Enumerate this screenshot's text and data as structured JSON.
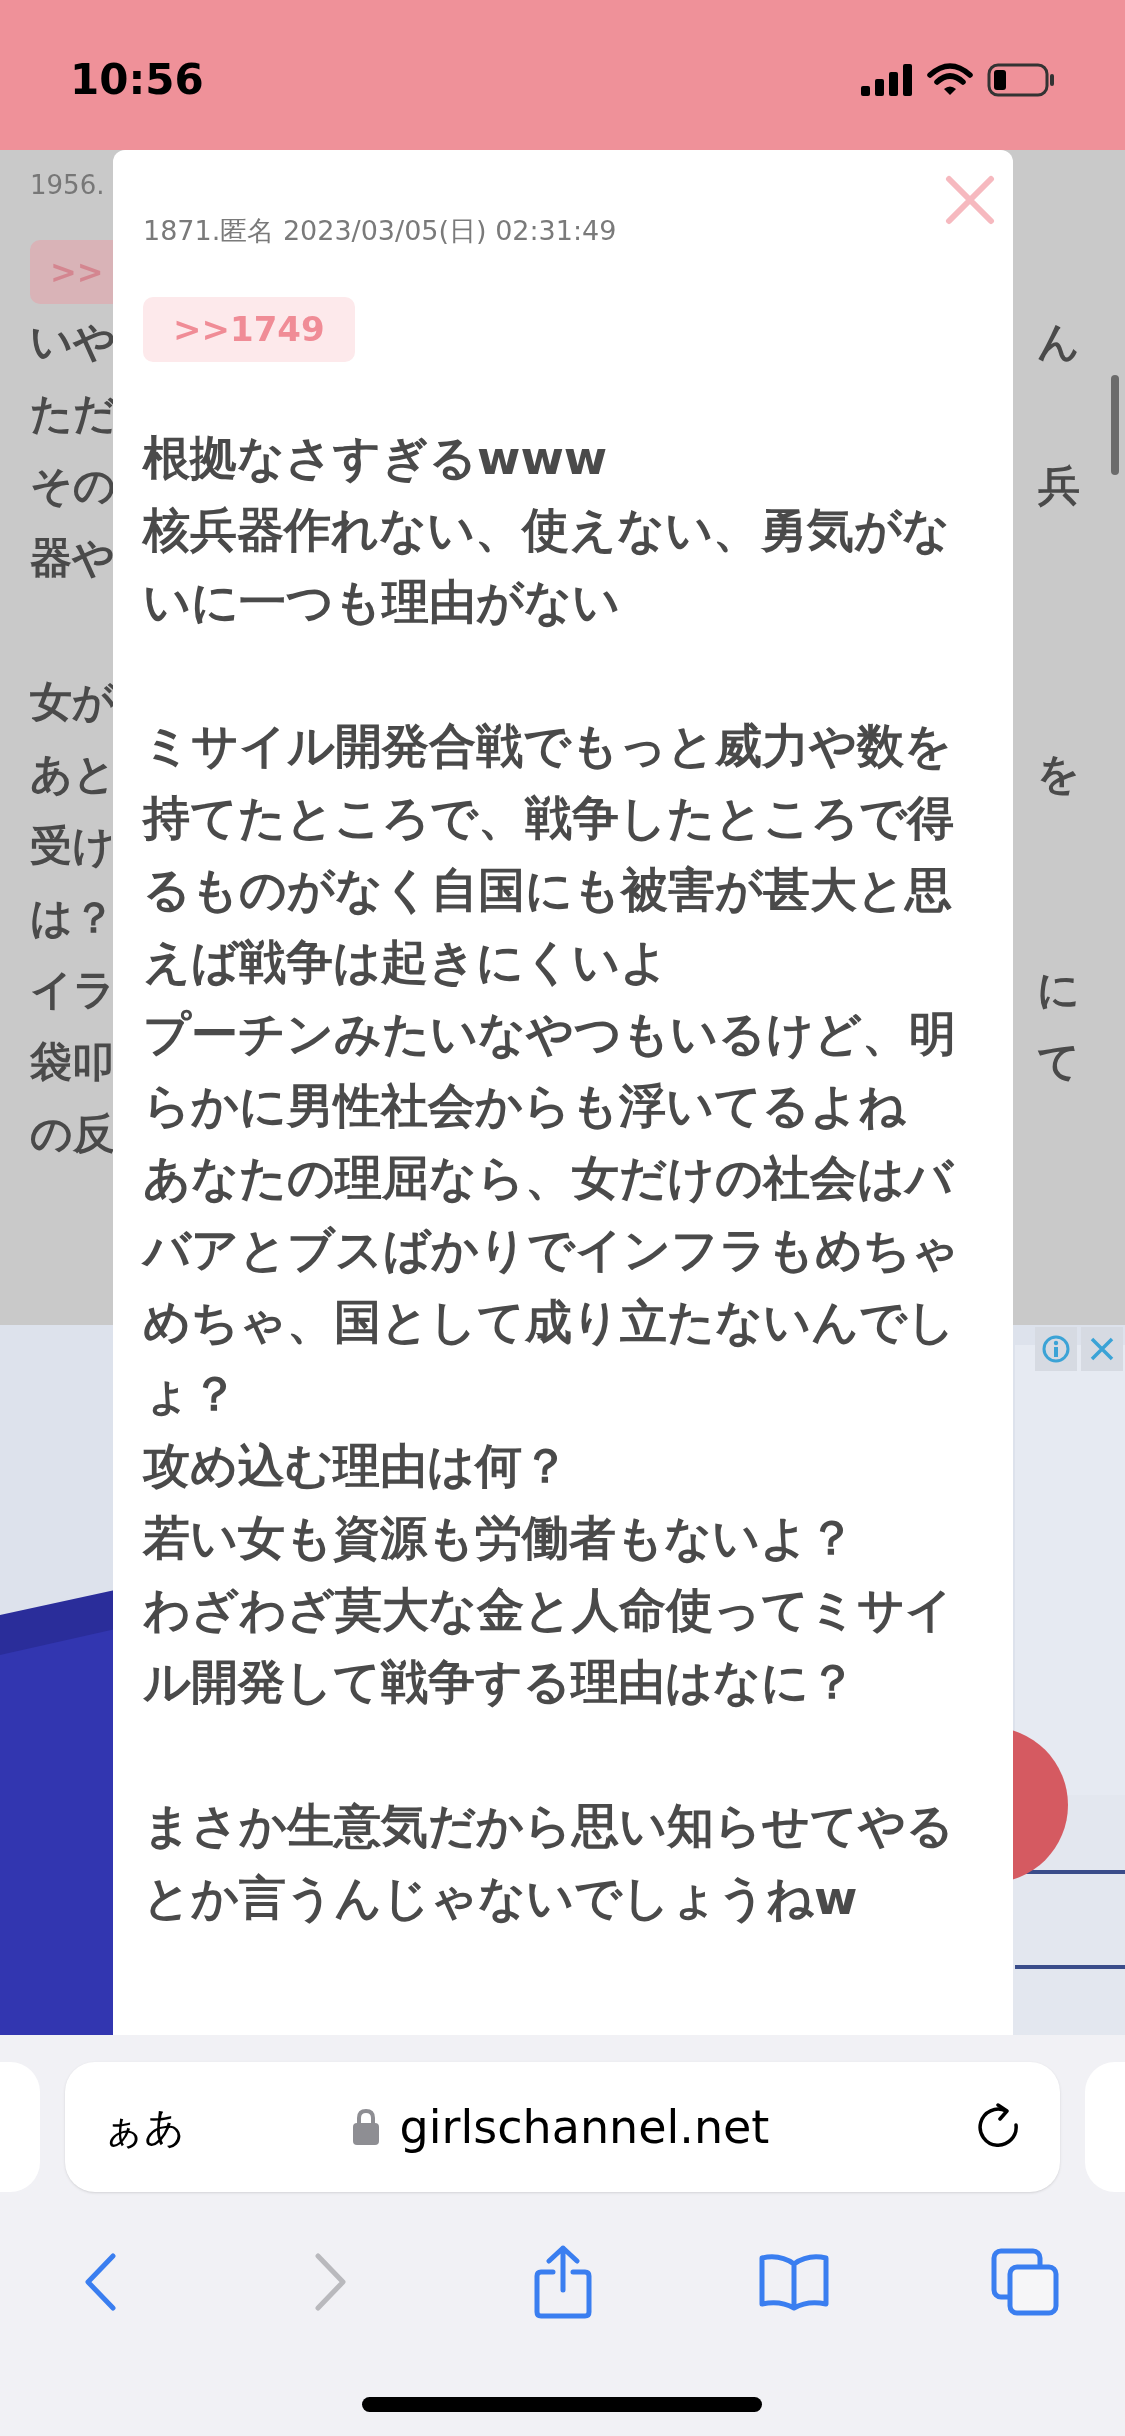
{
  "status_bar": {
    "time": "10:56"
  },
  "background_page": {
    "meta": "1956.",
    "reply_link": ">>",
    "paragraphs": [
      [
        {
          "left": "いや",
          "right": "ん"
        },
        {
          "left": "ただ"
        },
        {
          "left": "その",
          "right": "兵"
        },
        {
          "left": "器や"
        }
      ],
      [
        {
          "left": "女が"
        },
        {
          "left": "あと",
          "right": "を"
        },
        {
          "left": "受け"
        },
        {
          "left": "は？"
        },
        {
          "left": "イラ",
          "right": "に"
        },
        {
          "left": "袋叩",
          "right": "て"
        },
        {
          "left": "の反"
        }
      ]
    ]
  },
  "comment_popup": {
    "meta": "1871.匿名 2023/03/05(日) 02:31:49",
    "reply_link": ">>1749",
    "paragraphs": [
      [
        "根拠なさすぎるwww",
        "核兵器作れない、使えない、勇気がないに一つも理由がない"
      ],
      [
        "ミサイル開発合戦でもっと威力や数を持てたところで、戦争したところで得るものがなく自国にも被害が甚大と思えば戦争は起きにくいよ",
        "プーチンみたいなやつもいるけど、明らかに男性社会からも浮いてるよね",
        "あなたの理屈なら、女だけの社会はババアとブスばかりでインフラもめちゃめちゃ、国として成り立たないんでしょ？",
        "攻め込む理由は何？",
        "若い女も資源も労働者もないよ？",
        "わざわざ莫大な金と人命使ってミサイル開発して戦争する理由はなに？"
      ],
      [
        "まさか生意気だから思い知らせてやるとか言うんじゃないでしょうねw"
      ]
    ]
  },
  "browser": {
    "text_size_button": "ぁあ",
    "url": "girlschannel.net",
    "toolbar": [
      {
        "kind": "back",
        "disabled": false
      },
      {
        "kind": "forward",
        "disabled": true
      },
      {
        "kind": "share",
        "disabled": false
      },
      {
        "kind": "bookmarks",
        "disabled": false
      },
      {
        "kind": "tabs",
        "disabled": false
      }
    ]
  }
}
